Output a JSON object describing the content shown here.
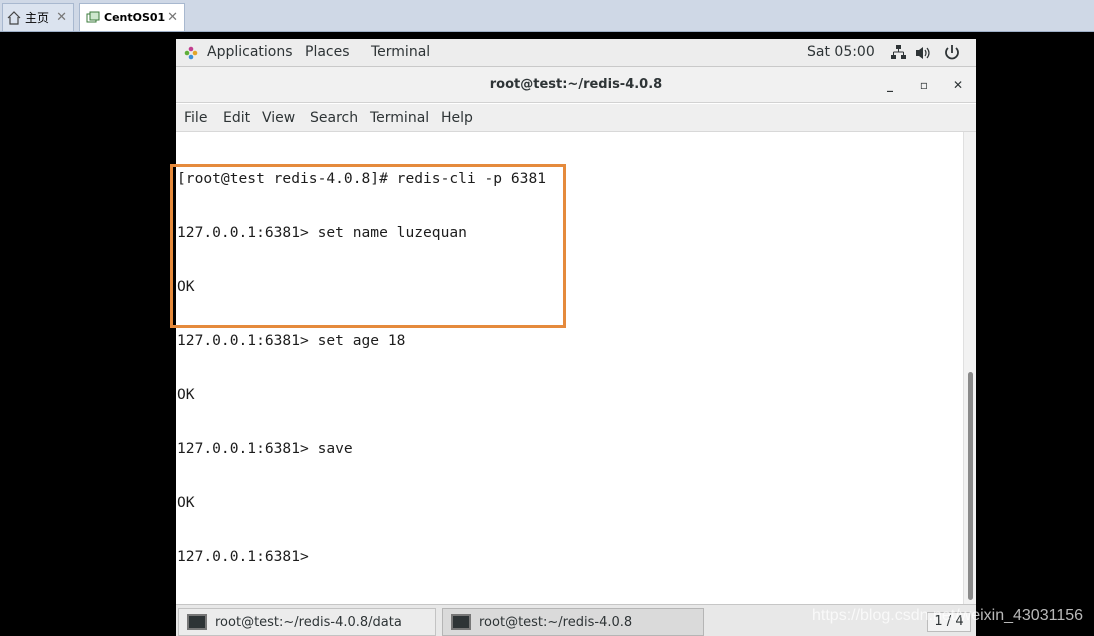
{
  "host": {
    "tabs": [
      {
        "label": "主页",
        "icon": "home-icon"
      },
      {
        "label": "CentOS01",
        "icon": "vm-icon"
      }
    ]
  },
  "gnome": {
    "menus": [
      "Applications",
      "Places",
      "Terminal"
    ],
    "clock": "Sat 05:00"
  },
  "window": {
    "title": "root@test:~/redis-4.0.8",
    "minimize": "_",
    "maximize": "▫",
    "close": "✕"
  },
  "menubar": [
    "File",
    "Edit",
    "View",
    "Search",
    "Terminal",
    "Help"
  ],
  "terminal": {
    "lines": [
      "[root@test redis-4.0.8]# redis-cli -p 6381",
      "127.0.0.1:6381> set name luzequan",
      "OK",
      "127.0.0.1:6381> set age 18",
      "OK",
      "127.0.0.1:6381> save",
      "OK",
      "127.0.0.1:6381> "
    ]
  },
  "taskbar": {
    "tasks": [
      "root@test:~/redis-4.0.8/data",
      "root@test:~/redis-4.0.8"
    ],
    "pager": "1 / 4"
  },
  "watermark": "https://blog.csdn.net/weixin_43031156",
  "colors": {
    "highlight": "#e58a3c"
  }
}
